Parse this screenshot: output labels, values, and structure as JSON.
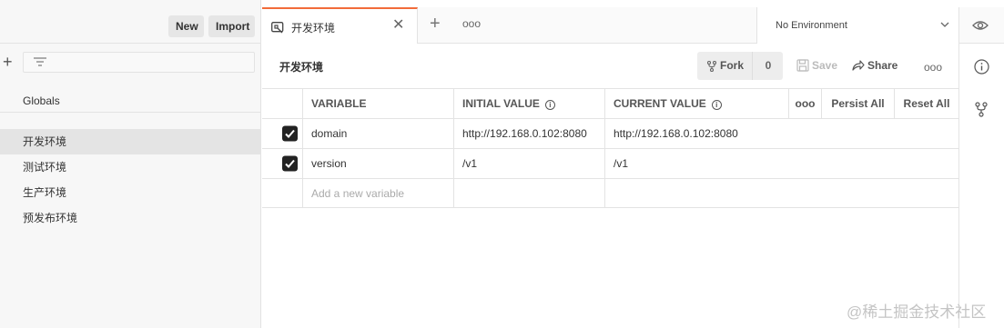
{
  "sidebar": {
    "new_label": "New",
    "import_label": "Import",
    "globals_label": "Globals",
    "environments": [
      {
        "label": "开发环境",
        "active": true
      },
      {
        "label": "测试环境",
        "active": false
      },
      {
        "label": "生产环境",
        "active": false
      },
      {
        "label": "预发布环境",
        "active": false
      }
    ]
  },
  "tabs": {
    "active_label": "开发环境",
    "more_label": "ooo",
    "environment_selector": "No Environment"
  },
  "header": {
    "title": "开发环境",
    "fork_label": "Fork",
    "fork_count": "0",
    "save_label": "Save",
    "share_label": "Share",
    "more_label": "ooo"
  },
  "table": {
    "columns": {
      "variable": "VARIABLE",
      "initial_value": "INITIAL VALUE",
      "current_value": "CURRENT VALUE",
      "more": "ooo",
      "persist_all": "Persist All",
      "reset_all": "Reset All"
    },
    "rows": [
      {
        "checked": true,
        "variable": "domain",
        "initial_value": "http://192.168.0.102:8080",
        "current_value": "http://192.168.0.102:8080"
      },
      {
        "checked": true,
        "variable": "version",
        "initial_value": "/v1",
        "current_value": "/v1"
      }
    ],
    "new_placeholder": "Add a new variable"
  },
  "watermark": "@稀土掘金技术社区",
  "colors": {
    "accent": "#f26b3a",
    "sidebar_bg": "#f7f7f7",
    "active_item_bg": "#e4e4e4"
  },
  "icons": [
    "plus-icon",
    "filter-icon",
    "environment-tab-icon",
    "close-icon",
    "eye-icon",
    "chevron-down-icon",
    "fork-icon",
    "save-icon",
    "share-icon",
    "info-icon",
    "checkmark-icon"
  ]
}
